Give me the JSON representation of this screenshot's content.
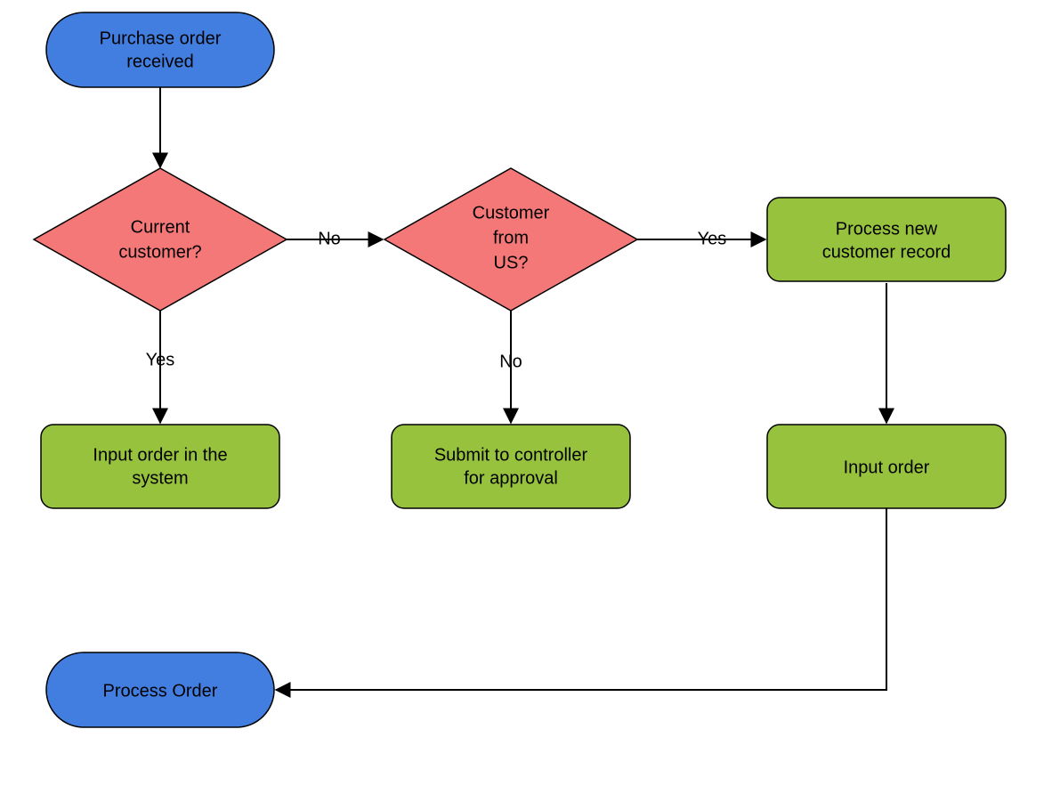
{
  "nodes": {
    "start": {
      "type": "terminator",
      "line1": "Purchase  order",
      "line2": "received"
    },
    "decision1": {
      "type": "decision",
      "line1": "Current",
      "line2": "customer?"
    },
    "decision2": {
      "type": "decision",
      "line1": "Customer",
      "line2": "from",
      "line3": "US?"
    },
    "process_new_record": {
      "type": "process",
      "line1": "Process new",
      "line2": "customer  record"
    },
    "input_order_system": {
      "type": "process",
      "line1": "Input order in the",
      "line2": "system"
    },
    "submit_controller": {
      "type": "process",
      "line1": "Submit to controller",
      "line2": "for approval"
    },
    "input_order": {
      "type": "process",
      "line1": "Input order"
    },
    "end": {
      "type": "terminator",
      "line1": "Process Order"
    }
  },
  "edges": {
    "d1_no": "No",
    "d1_yes": "Yes",
    "d2_yes": "Yes",
    "d2_no": "No"
  },
  "colors": {
    "terminator": "#417ee0",
    "decision": "#f57878",
    "process": "#96c23d"
  }
}
